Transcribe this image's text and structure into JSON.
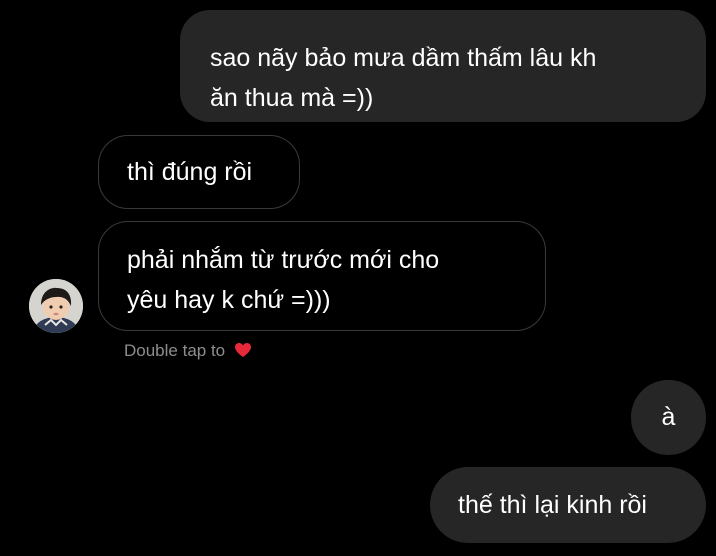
{
  "messages": [
    {
      "id": "msg1",
      "direction": "sent",
      "lines": [
        "sao nãy bảo mưa dầm thấm lâu kh",
        "ăn thua mà =))"
      ]
    },
    {
      "id": "msg2",
      "direction": "received",
      "lines": [
        "thì đúng rồi"
      ]
    },
    {
      "id": "msg3",
      "direction": "received",
      "lines": [
        "phải nhắm từ trước mới cho",
        "yêu hay k chứ =)))"
      ]
    },
    {
      "id": "msg4",
      "direction": "sent",
      "lines": [
        "à"
      ]
    },
    {
      "id": "msg5",
      "direction": "sent",
      "lines": [
        "thế thì lại kinh rồi"
      ]
    }
  ],
  "double_tap_hint": "Double tap to",
  "icons": {
    "heart": "heart-icon",
    "avatar": "contact-avatar"
  },
  "colors": {
    "background": "#000000",
    "sent_bubble": "#262626",
    "received_border": "#3a3a3a",
    "text": "#ffffff",
    "hint_text": "#8e8e8e",
    "heart": "#e8293b"
  }
}
